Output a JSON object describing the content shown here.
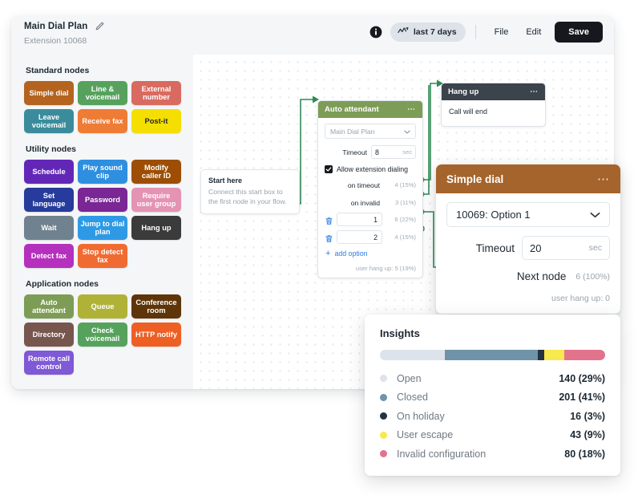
{
  "header": {
    "title": "Main Dial Plan",
    "subtitle": "Extension 10068",
    "edit_icon": "pencil-icon",
    "info_icon": "info-icon",
    "range_icon": "activity-chart-icon",
    "range_label": "last 7 days",
    "file_label": "File",
    "edit_label": "Edit",
    "save_label": "Save"
  },
  "palette": {
    "groups": [
      {
        "title": "Standard nodes",
        "nodes": [
          {
            "label": "Simple dial",
            "color": "#b4641f"
          },
          {
            "label": "Line & voicemail",
            "color": "#56a25d"
          },
          {
            "label": "External number",
            "color": "#d96a60"
          },
          {
            "label": "Leave voicemail",
            "color": "#3a8c9c"
          },
          {
            "label": "Receive fax",
            "color": "#ef7c35"
          },
          {
            "label": "Post-it",
            "color": "#f5df00",
            "text": "#1c2833"
          }
        ]
      },
      {
        "title": "Utility nodes",
        "nodes": [
          {
            "label": "Schedule",
            "color": "#6327b8"
          },
          {
            "label": "Play sound clip",
            "color": "#2e8fe0"
          },
          {
            "label": "Modify caller ID",
            "color": "#9d4e04"
          },
          {
            "label": "Set language",
            "color": "#263b9b"
          },
          {
            "label": "Password",
            "color": "#7a2694"
          },
          {
            "label": "Require user group",
            "color": "#e593b2"
          },
          {
            "label": "Wait",
            "color": "#70828f"
          },
          {
            "label": "Jump to dial plan",
            "color": "#2e9ae6"
          },
          {
            "label": "Hang up",
            "color": "#3b3b3b"
          },
          {
            "label": "Detect fax",
            "color": "#b530bd"
          },
          {
            "label": "Stop detect fax",
            "color": "#f06b32"
          }
        ]
      },
      {
        "title": "Application nodes",
        "nodes": [
          {
            "label": "Auto attendant",
            "color": "#7d9c56"
          },
          {
            "label": "Queue",
            "color": "#b0b238"
          },
          {
            "label": "Conference room",
            "color": "#5d3508"
          },
          {
            "label": "Directory",
            "color": "#77564e"
          },
          {
            "label": "Check voicemail",
            "color": "#56a25d"
          },
          {
            "label": "HTTP notify",
            "color": "#ee5f24"
          },
          {
            "label": "Remote call control",
            "color": "#7f59d6"
          }
        ]
      }
    ]
  },
  "canvas": {
    "start_here": {
      "title": "Start here",
      "description": "Connect this start box to the first node in your flow."
    },
    "auto_attendant": {
      "header_title": "Auto attendant",
      "menu_icon": "ellipsis-icon",
      "select_value": "Main Dial Plan",
      "chevron_icon": "chevron-down-icon",
      "timeout_label": "Timeout",
      "timeout_value": "8",
      "timeout_unit": "sec",
      "checkbox_icon": "checkmark-icon",
      "checkbox_label": "Allow extension dialing",
      "outputs": [
        {
          "label": "on timeout",
          "stat": "4 (15%)",
          "connected": true
        },
        {
          "label": "on invalid",
          "stat": "3 (11%)",
          "connected": true
        }
      ],
      "options": [
        {
          "trash_icon": "trash-icon",
          "value": "1",
          "stat": "6 (22%)",
          "connected": true
        },
        {
          "trash_icon": "trash-icon",
          "value": "2",
          "stat": "4 (15%)",
          "connected": false
        }
      ],
      "add_option_label": "add option",
      "plus_icon": "plus-icon",
      "user_hang_up": "user hang up: 5 (19%)"
    },
    "hang_up": {
      "header_title": "Hang up",
      "menu_icon": "ellipsis-icon",
      "body_text": "Call will end"
    }
  },
  "simple_dial": {
    "header_title": "Simple dial",
    "menu_icon": "ellipsis-icon",
    "select_value": "10069: Option 1",
    "chevron_icon": "chevron-down-icon",
    "timeout_label": "Timeout",
    "timeout_value": "20",
    "timeout_unit": "sec",
    "next_node_label": "Next node",
    "next_node_stat": "6 (100%)",
    "user_hang_up": "user hang up: 0"
  },
  "insights": {
    "title": "Insights"
  },
  "chart_data": {
    "type": "bar",
    "title": "Insights",
    "layout": "stacked-horizontal-bar-with-legend",
    "total": 480,
    "categories": [
      "Open",
      "Closed",
      "On holiday",
      "User escape",
      "Invalid configuration"
    ],
    "values": [
      140,
      201,
      16,
      43,
      80
    ],
    "percents": [
      29,
      41,
      3,
      9,
      18
    ],
    "value_labels": [
      "140 (29%)",
      "201 (41%)",
      "16 (3%)",
      "43 (9%)",
      "80 (18%)"
    ],
    "colors": [
      "#dce3ea",
      "#6f93a8",
      "#253240",
      "#f7e94e",
      "#e2738c"
    ],
    "xlabel": "",
    "ylabel": "",
    "grid": false,
    "legend": "below"
  }
}
